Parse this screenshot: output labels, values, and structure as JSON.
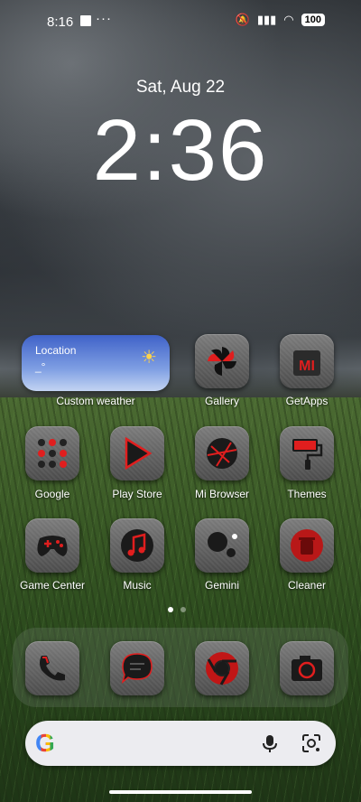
{
  "status": {
    "time": "8:16",
    "dots": "···",
    "battery": "100"
  },
  "lock": {
    "date": "Sat, Aug 22",
    "time": "2:36"
  },
  "weather_widget": {
    "location": "Location",
    "temp": "_°",
    "label": "Custom weather"
  },
  "apps": [
    {
      "id": "gallery",
      "label": "Gallery",
      "icon": "pinwheel-icon"
    },
    {
      "id": "getapps",
      "label": "GetApps",
      "icon": "mi-bag-icon"
    },
    {
      "id": "google",
      "label": "Google",
      "icon": "google-folder-icon"
    },
    {
      "id": "playstore",
      "label": "Play Store",
      "icon": "play-icon"
    },
    {
      "id": "mibrowser",
      "label": "Mi Browser",
      "icon": "browser-icon"
    },
    {
      "id": "themes",
      "label": "Themes",
      "icon": "paint-roller-icon"
    },
    {
      "id": "gamecenter",
      "label": "Game Center",
      "icon": "gamepad-icon"
    },
    {
      "id": "music",
      "label": "Music",
      "icon": "music-note-icon"
    },
    {
      "id": "gemini",
      "label": "Gemini",
      "icon": "gemini-icon"
    },
    {
      "id": "cleaner",
      "label": "Cleaner",
      "icon": "trash-icon"
    }
  ],
  "dock": [
    {
      "id": "phone",
      "icon": "phone-icon"
    },
    {
      "id": "messages",
      "icon": "message-icon"
    },
    {
      "id": "chrome",
      "icon": "chrome-icon"
    },
    {
      "id": "camera",
      "icon": "camera-icon"
    }
  ],
  "search": {
    "logo": "G"
  },
  "colors": {
    "accent": "#e01e1e",
    "icon_bg": "#5a5a5a"
  }
}
